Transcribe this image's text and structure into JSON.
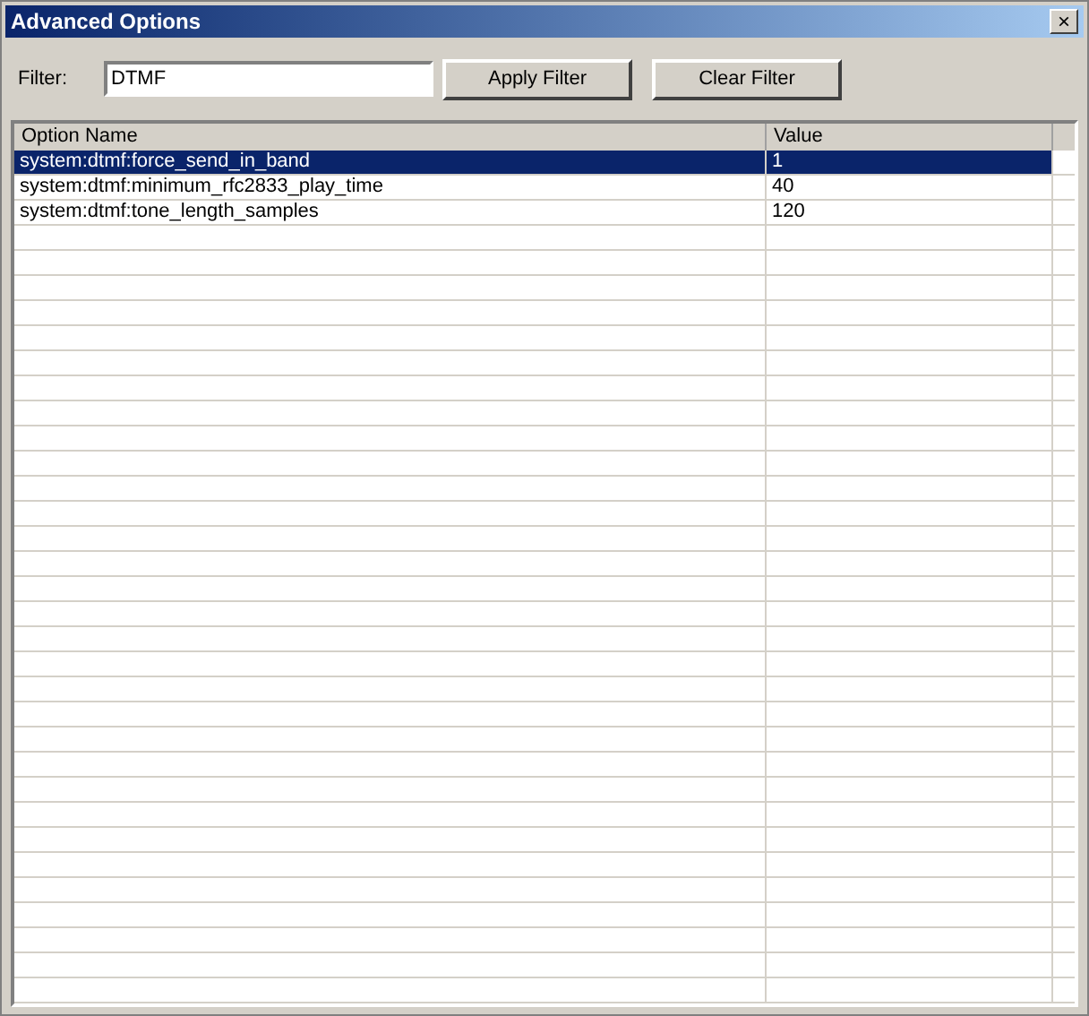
{
  "window": {
    "title": "Advanced Options",
    "close": "×"
  },
  "filter": {
    "label": "Filter:",
    "value": "DTMF"
  },
  "buttons": [
    "Apply Filter",
    "Clear Filter"
  ],
  "table": {
    "columns": [
      "Option Name",
      "Value"
    ],
    "rows": [
      {
        "name": "system:dtmf:force_send_in_band",
        "value": "1",
        "selected": true
      },
      {
        "name": "system:dtmf:minimum_rfc2833_play_time",
        "value": "40",
        "selected": false
      },
      {
        "name": "system:dtmf:tone_length_samples",
        "value": "120",
        "selected": false
      }
    ]
  }
}
